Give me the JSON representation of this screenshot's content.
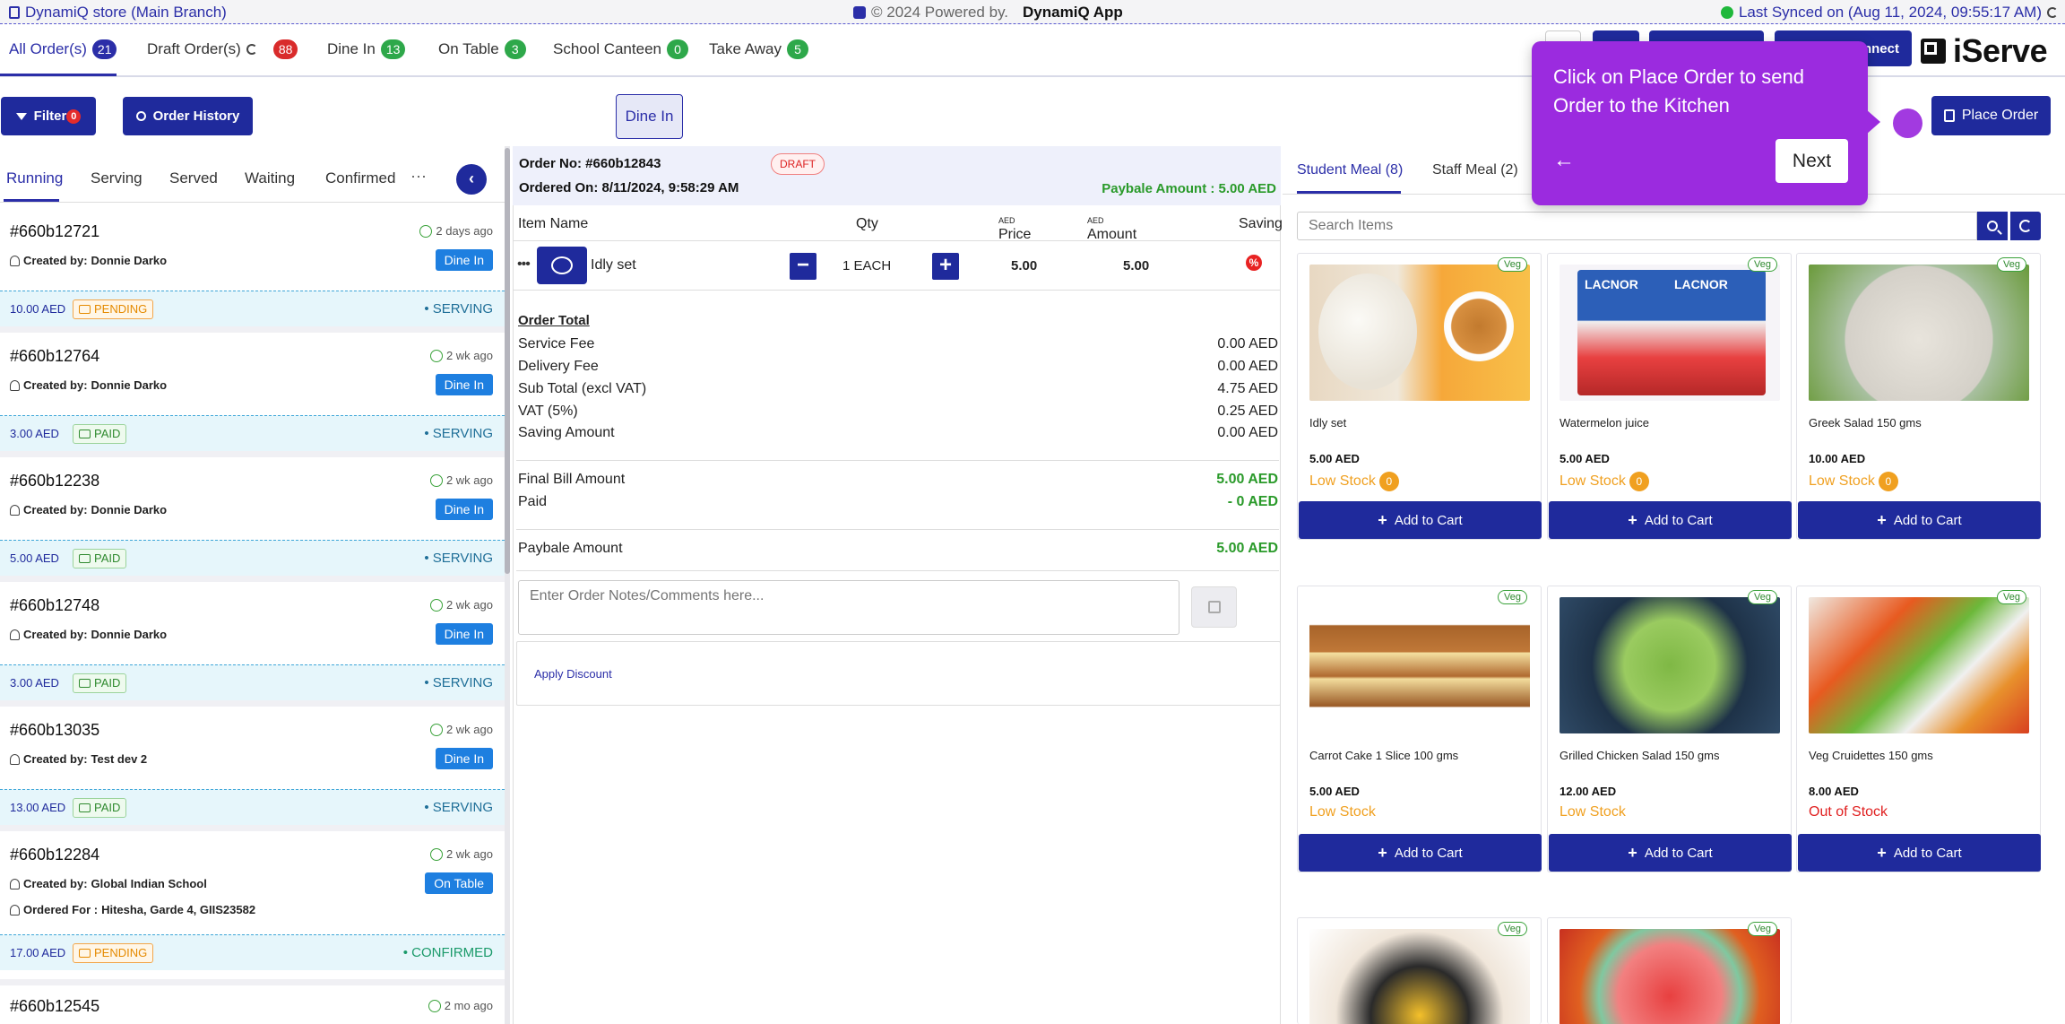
{
  "topbar": {
    "store": "DynamiQ store (Main Branch)",
    "powered": "© 2024 Powered by.",
    "powered_app": "DynamiQ App",
    "sync": "Last Synced on (Aug 11, 2024, 09:55:17 AM)",
    "sync_status_color": "#1fb83b"
  },
  "order_tabs": [
    {
      "label": "All Order(s)",
      "count": "21",
      "color": "#2b2ea8"
    },
    {
      "label": "Draft Order(s)",
      "count": "88",
      "color": "#d92b2b"
    },
    {
      "label": "Dine In",
      "count": "13",
      "color": "#2ea84a"
    },
    {
      "label": "On Table",
      "count": "3",
      "color": "#2ea84a"
    },
    {
      "label": "School Canteen",
      "count": "0",
      "color": "#2ea84a"
    },
    {
      "label": "Take Away",
      "count": "5",
      "color": "#2ea84a"
    }
  ],
  "header": {
    "connect_label": "nnect",
    "logo_text": "iServe"
  },
  "toolbar": {
    "filter_label": "Filter",
    "filter_count": "0",
    "history_label": "Order History",
    "order_type_chip": "Dine In",
    "place_order_label": "Place Order"
  },
  "status_tabs": [
    "Running",
    "Serving",
    "Served",
    "Waiting",
    "Confirmed"
  ],
  "status_more": "···",
  "orders": [
    {
      "no": "#660b12721",
      "ago": "2 days ago",
      "by_label": "Created by:",
      "by": "Donnie Darko",
      "type": "Dine In",
      "amount": "10.00 AED",
      "payment": "PENDING",
      "state": "SERVING"
    },
    {
      "no": "#660b12764",
      "ago": "2 wk ago",
      "by_label": "Created by:",
      "by": "Donnie Darko",
      "type": "Dine In",
      "amount": "3.00 AED",
      "payment": "PAID",
      "state": "SERVING"
    },
    {
      "no": "#660b12238",
      "ago": "2 wk ago",
      "by_label": "Created by:",
      "by": "Donnie Darko",
      "type": "Dine In",
      "amount": "5.00 AED",
      "payment": "PAID",
      "state": "SERVING"
    },
    {
      "no": "#660b12748",
      "ago": "2 wk ago",
      "by_label": "Created by:",
      "by": "Donnie Darko",
      "type": "Dine In",
      "amount": "3.00 AED",
      "payment": "PAID",
      "state": "SERVING"
    },
    {
      "no": "#660b13035",
      "ago": "2 wk ago",
      "by_label": "Created by:",
      "by": "Test dev 2",
      "type": "Dine In",
      "amount": "13.00 AED",
      "payment": "PAID",
      "state": "SERVING"
    },
    {
      "no": "#660b12284",
      "ago": "2 wk ago",
      "by_label": "Created by:",
      "by": "Global Indian School",
      "for_label": "Ordered For :",
      "for": "Hitesha, Garde 4, GIIS23582",
      "type": "On Table",
      "amount": "17.00 AED",
      "payment": "PENDING",
      "state": "CONFIRMED"
    },
    {
      "no": "#660b12545",
      "ago": "2 mo ago"
    }
  ],
  "order": {
    "no_label": "Order No: #660b12843",
    "status": "DRAFT",
    "date_label": "Ordered On: 8/11/2024, 9:58:29 AM",
    "paybale_top": "Paybale Amount : 5.00 AED",
    "columns": {
      "item": "Item Name",
      "qty": "Qty",
      "price": "Price",
      "price_unit": "AED",
      "amount": "Amount",
      "amount_unit": "AED",
      "saving": "Saving"
    },
    "item": {
      "more": "•••",
      "name": "Idly set",
      "qty": "1 EACH",
      "price": "5.00",
      "amount": "5.00",
      "minus": "−",
      "plus": "+"
    },
    "total_title": "Order Total",
    "lines": [
      {
        "label": "Service Fee",
        "value": "0.00 AED"
      },
      {
        "label": "Delivery Fee",
        "value": "0.00 AED"
      },
      {
        "label": "Sub Total (excl VAT)",
        "value": "4.75 AED"
      },
      {
        "label": "VAT (5%)",
        "value": "0.25 AED"
      },
      {
        "label": "Saving Amount",
        "value": "0.00 AED"
      }
    ],
    "final_label": "Final Bill Amount",
    "final_value": "5.00 AED",
    "paid_label": "Paid",
    "paid_value": "- 0 AED",
    "paybale_label": "Paybale Amount",
    "paybale_value": "5.00 AED",
    "notes_placeholder": "Enter Order Notes/Comments here...",
    "discount_label": "Apply Discount"
  },
  "menu": {
    "tabs": [
      {
        "label": "Student Meal (8)"
      },
      {
        "label": "Staff Meal (2)"
      }
    ],
    "search_placeholder": "Search Items",
    "add_label": "Add to Cart",
    "veg_label": "Veg",
    "products": [
      {
        "name": "Idly set",
        "price": "5.00 AED",
        "stock": "Low Stock",
        "stock_count": "0",
        "img": "idly"
      },
      {
        "name": "Watermelon juice",
        "price": "5.00 AED",
        "stock": "Low Stock",
        "stock_count": "0",
        "img": "juice"
      },
      {
        "name": "Greek Salad 150 gms",
        "price": "10.00 AED",
        "stock": "Low Stock",
        "stock_count": "0",
        "img": "salad"
      },
      {
        "name": "Carrot Cake 1 Slice 100 gms",
        "price": "5.00 AED",
        "stock": "Low Stock",
        "img": "cake"
      },
      {
        "name": "Grilled Chicken Salad 150 gms",
        "price": "12.00 AED",
        "stock": "Low Stock",
        "img": "grilled"
      },
      {
        "name": "Veg Cruidettes 150 gms",
        "price": "8.00 AED",
        "stock": "Out of Stock",
        "img": "veg"
      },
      {
        "img": "corn"
      },
      {
        "img": "fruit"
      }
    ]
  },
  "tooltip": {
    "text": "Click on Place Order to send Order to the Kitchen",
    "back": "←",
    "next": "Next"
  },
  "colors": {
    "primary": "#1f2a9c",
    "accent": "#2b2ea8",
    "tooltip": "#9b2bdf",
    "success": "#2a9a2a",
    "warning": "#f0a020",
    "danger": "#e02020"
  }
}
